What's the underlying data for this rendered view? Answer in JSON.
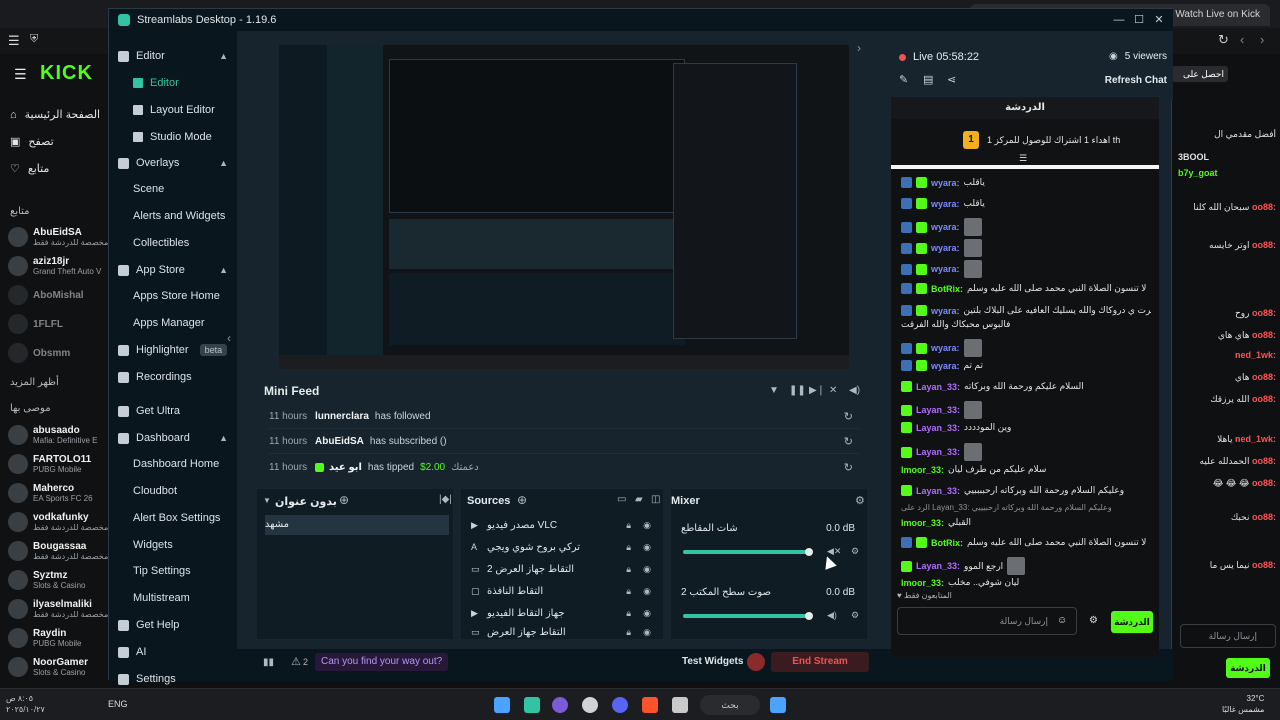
{
  "kick": {
    "browser_tab_title": "Watch Live on Kick",
    "home": "الصفحة الرئيسية",
    "browse": "تصفح",
    "following": "متابع",
    "following_header": "متابع",
    "show_more": "أظهر المزيد",
    "recommended": "موصى بها",
    "followed_channels": [
      {
        "name": "AbuEidSA",
        "sub": "مخصصة للدردشة فقط"
      },
      {
        "name": "aziz18jr",
        "sub": "Grand Theft Auto V"
      },
      {
        "name": "AboMishal",
        "sub": ""
      },
      {
        "name": "1FLFL",
        "sub": ""
      },
      {
        "name": "Obsmm",
        "sub": ""
      }
    ],
    "recommended_channels": [
      {
        "name": "abusaado",
        "sub": "Mafia: Definitive E"
      },
      {
        "name": "FARTOLO11",
        "sub": "PUBG Mobile"
      },
      {
        "name": "Maherco",
        "sub": "EA Sports FC 26"
      },
      {
        "name": "vodkafunky",
        "sub": "مخصصة للدردشة فقط"
      },
      {
        "name": "Bougassaa",
        "sub": "مخصصة للدردشة فقط"
      },
      {
        "name": "Syztmz",
        "sub": "Slots & Casino"
      },
      {
        "name": "ilyaselmaliki",
        "sub": "مخصصة للدردشة فقط"
      },
      {
        "name": "Raydin",
        "sub": "PUBG Mobile"
      },
      {
        "name": "NoorGamer",
        "sub": "Slots & Casino"
      }
    ],
    "right_top_button": "احصل على",
    "right_leaderboard": "أفضل مقدمي ال",
    "right_lines": [
      {
        "user": "3BOOL",
        "text": ""
      },
      {
        "user": "b7y_goat",
        "text": ""
      },
      {
        "user": "oo88:",
        "text": "سبحان الله كلنا"
      },
      {
        "user": "oo88:",
        "text": "اوتر خايسه"
      },
      {
        "user": "oo88:",
        "text": "روح"
      },
      {
        "user": "oo88:",
        "text": "هاي هاي"
      },
      {
        "user": "ned_1wk:",
        "text": ""
      },
      {
        "user": "oo88:",
        "text": "هاي"
      },
      {
        "user": "oo88:",
        "text": "الله يرزقك"
      },
      {
        "user": "ned_1wk:",
        "text": "ياهلا"
      },
      {
        "user": "oo88:",
        "text": "الحمدلله عليه"
      },
      {
        "user": "oo88:",
        "text": "😂 😂 😂"
      },
      {
        "user": "oo88:",
        "text": "نحبك"
      },
      {
        "user": "oo88:",
        "text": "نيما يس ما"
      }
    ],
    "right_input_placeholder": "إرسال رسالة",
    "right_send": "الدردشة",
    "taskbar_lang": "ENG",
    "taskbar_search": "بحث",
    "taskbar_time": "٨:٠٥ ص",
    "taskbar_date": "٢٠٢٥/١٠/٢٧",
    "weather": "32°C",
    "weather_desc": "مشمس غالبًا"
  },
  "streamlabs": {
    "title": "Streamlabs Desktop - 1.19.6",
    "nav": {
      "editor_group": "Editor",
      "editor": "Editor",
      "layout_editor": "Layout Editor",
      "studio_mode": "Studio Mode",
      "overlays": "Overlays",
      "scene": "Scene",
      "alerts_widgets": "Alerts and Widgets",
      "collectibles": "Collectibles",
      "app_store": "App Store",
      "apps_store_home": "Apps Store Home",
      "apps_manager": "Apps Manager",
      "highlighter": "Highlighter",
      "beta": "beta",
      "recordings": "Recordings",
      "get_ultra": "Get Ultra",
      "dashboard": "Dashboard",
      "dashboard_home": "Dashboard Home",
      "cloudbot": "Cloudbot",
      "alert_box_settings": "Alert Box Settings",
      "widgets": "Widgets",
      "tip_settings": "Tip Settings",
      "multistream": "Multistream",
      "get_help": "Get Help",
      "ai": "AI",
      "settings": "Settings"
    },
    "mini_feed": {
      "title": "Mini Feed",
      "rows": [
        {
          "time": "11 hours",
          "user": "lunnerclara",
          "action": "has followed",
          "amount": "",
          "message": ""
        },
        {
          "time": "11 hours",
          "user": "AbuEidSA",
          "action": "has subscribed ()",
          "amount": "",
          "message": ""
        },
        {
          "time": "11 hours",
          "user": "ابو عيد",
          "action": "has tipped",
          "amount": "$2.00",
          "message": "دعمتك"
        }
      ]
    },
    "scenes": {
      "title": "بدون عنوان",
      "items": [
        "مشهد"
      ]
    },
    "sources": {
      "title": "Sources",
      "items": [
        "مصدر فيديو VLC",
        "تركي بروح شوي ويجي",
        "التقاط جهاز العرض 2",
        "التقاط النافذة",
        "جهاز التقاط الفيديو",
        "التقاط جهاز العرض"
      ]
    },
    "mixer": {
      "title": "Mixer",
      "channels": [
        {
          "name": "شات المقاطع",
          "db": "0.0 dB",
          "level": 1.0
        },
        {
          "name": "صوت سطح المكتب 2",
          "db": "0.0 dB",
          "level": 1.0
        }
      ]
    },
    "footer": {
      "notif_count": "2",
      "ask": "Can you find your way out?",
      "test_widgets": "Test Widgets",
      "end_stream": "End Stream"
    },
    "live": {
      "status": "Live 05:58:22",
      "viewers": "5 viewers",
      "refresh_chat": "Refresh Chat"
    },
    "chat": {
      "title": "الدردشة",
      "pinned": "اهداء 1 اشتراك للوصول للمركز 1 th",
      "pinned_rank": "1",
      "messages": [
        {
          "badge": "blue",
          "user": "wyara:",
          "text": "ياقلب",
          "img": false
        },
        {
          "badge": "blue",
          "user": "wyara:",
          "text": "ياقلب",
          "img": false
        },
        {
          "badge": "blue",
          "user": "wyara:",
          "text": "",
          "img": true
        },
        {
          "badge": "blue",
          "user": "wyara:",
          "text": "",
          "img": true
        },
        {
          "badge": "blue",
          "user": "wyara:",
          "text": "",
          "img": true
        },
        {
          "badge": "green",
          "user": "BotRix:",
          "text": "لا تنسون الصلاة النبي محمد صلى الله عليه وسلم",
          "img": false
        },
        {
          "badge": "blue",
          "user": "wyara:",
          "text": "م تصرت ي دروكاك والله يسليك العافيه على البلاك بلتين",
          "img": false
        },
        {
          "badge": "",
          "user": "",
          "text": "فالبوس محبكاك والله الفرقت",
          "img": false
        },
        {
          "badge": "blue",
          "user": "wyara:",
          "text": "",
          "img": true
        },
        {
          "badge": "blue",
          "user": "wyara:",
          "text": "تم تم",
          "img": false
        },
        {
          "badge": "green",
          "user": "Layan_33:",
          "text": "السلام عليكم ورحمة الله وبركاته",
          "img": false
        },
        {
          "badge": "green",
          "user": "Layan_33:",
          "text": "",
          "img": true
        },
        {
          "badge": "green",
          "user": "Layan_33:",
          "text": "وين المودددد",
          "img": false
        },
        {
          "badge": "green",
          "user": "Layan_33:",
          "text": "",
          "img": true
        },
        {
          "badge": "",
          "user": "lmoor_33:",
          "text": "سلام عليكم من طرف ليان",
          "img": false
        },
        {
          "badge": "green",
          "user": "Layan_33:",
          "text": "وعليكم السلام ورحمة الله وبركاته ارحببببيي",
          "img": false
        },
        {
          "badge": "",
          "user": "",
          "text": "الرد على Layan_33: وعليكم السلام ورحمة الله وبركاته ارحبيييي",
          "img": false
        },
        {
          "badge": "",
          "user": "lmoor_33:",
          "text": "القبلي",
          "img": false
        },
        {
          "badge": "green",
          "user": "BotRix:",
          "text": "لا تنسون الصلاة النبي محمد صلى الله عليه وسلم",
          "img": false
        },
        {
          "badge": "green",
          "user": "Layan_33:",
          "text": "ارجع الموو",
          "img": true
        },
        {
          "badge": "",
          "user": "lmoor_33:",
          "text": "ليان شوفي.. مخلب",
          "img": false
        }
      ],
      "followers_only": "المتابعون فقط",
      "input_placeholder": "إرسال رسالة",
      "send": "الدردشة"
    }
  },
  "colors": {
    "kick_green": "#53fc18",
    "streamlabs_teal": "#31c3a2",
    "end_stream_red": "#ef5350"
  }
}
